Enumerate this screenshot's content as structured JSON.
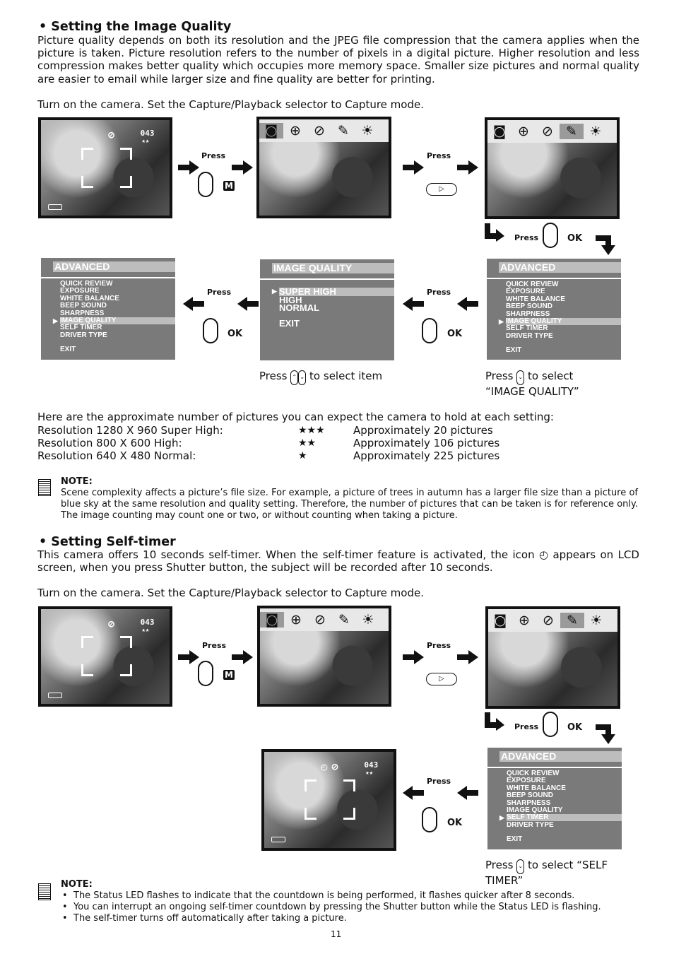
{
  "section1": {
    "heading": "• Setting the Image Quality",
    "paragraph": "Picture quality depends on both its resolution and the JPEG file compression that the camera applies when the picture is taken.  Picture resolution refers to the number of pixels in a digital picture.  Higher resolution and less compression makes better quality which occupies more memory space.  Smaller size pictures and normal quality are easier to email while larger size and fine quality are better for printing.",
    "instruction": "Turn on the camera.  Set the Capture/Playback selector to Capture mode.",
    "caption_select_item": {
      "pre": "Press",
      "post": "to select item"
    },
    "caption_select_quality": {
      "pre": "Press",
      "post": "to select “IMAGE QUALITY”"
    },
    "capacity_intro": "Here are the approximate number of pictures you can expect the camera to hold at each setting:",
    "capacity": [
      {
        "resolution": "Resolution 1280 X 960 Super High:",
        "stars": "★★★",
        "count": "Approximately 20 pictures"
      },
      {
        "resolution": "Resolution 800 X 600 High:",
        "stars": "★★",
        "count": "Approximately 106 pictures"
      },
      {
        "resolution": "Resolution 640 X 480 Normal:",
        "stars": "★",
        "count": "Approximately 225 pictures"
      }
    ],
    "note_title": "NOTE:",
    "note": "Scene complexity affects a picture’s file size.  For example, a picture of trees in autumn has a larger file size than a picture of blue sky at the same resolution and quality setting.  Therefore, the number of pictures that can be taken is for reference only.  The image counting may count one or two, or without counting when taking a picture."
  },
  "section2": {
    "heading": "• Setting Self-timer",
    "paragraph_pre": "This camera offers 10 seconds self-timer.  When the self-timer feature is activated, the icon",
    "paragraph_post": "appears on LCD screen, when you press Shutter button, the subject will be recorded after 10 seconds.",
    "instruction": "Turn on the camera.  Set the Capture/Playback selector to Capture mode.",
    "caption_select": {
      "pre": "Press",
      "post": "to select “SELF TIMER”"
    },
    "note_title": "NOTE:",
    "notes": [
      "The Status LED flashes to indicate that the countdown is being performed, it flashes quicker after 8 seconds.",
      "You can interrupt an ongoing self-timer countdown by pressing the Shutter button while the Status LED is flashing.",
      "The self-timer turns off automatically after taking a picture."
    ]
  },
  "ui": {
    "press": "Press",
    "ok": "OK",
    "m_key": "M",
    "play_key": "▷",
    "shot_count": "043",
    "quality_stars": "★★",
    "toolbar_icons": [
      "camera-icon",
      "zoom-in-icon",
      "flash-off-icon",
      "wrench-icon",
      "brightness-icon"
    ],
    "toolbar_glyphs": [
      "◙",
      "⊕",
      "⊘",
      "✎",
      "☀"
    ],
    "self_timer_glyph": "◴",
    "flash_glyph": "⊘"
  },
  "advanced_menu": {
    "title": "ADVANCED",
    "items": [
      "QUICK REVIEW",
      "EXPOSURE",
      "WHITE BALANCE",
      "BEEP SOUND",
      "SHARPNESS",
      "IMAGE QUALITY",
      "SELF TIMER",
      "DRIVER TYPE"
    ],
    "exit": "EXIT"
  },
  "quality_menu": {
    "title": "IMAGE QUALITY",
    "items": [
      "SUPER HIGH",
      "HIGH",
      "NORMAL"
    ],
    "exit": "EXIT"
  },
  "state": {
    "advanced_selected_s1": 5,
    "quality_selected": 0,
    "advanced_selected_s2": 6,
    "toolbar_selected_step2": 0,
    "toolbar_selected_step3": 3
  },
  "page_number": "11"
}
